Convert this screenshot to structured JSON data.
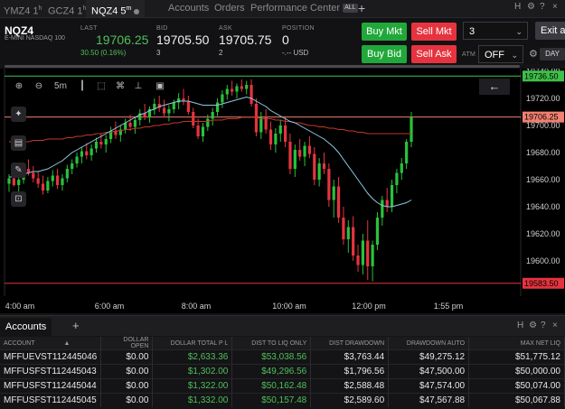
{
  "tabs": [
    {
      "label": "YMZ4 1",
      "sup": "h"
    },
    {
      "label": "GCZ4 1",
      "sup": "h"
    },
    {
      "label": "NQZ4 5",
      "sup": "m"
    },
    {
      "label": "Accounts"
    },
    {
      "label": "Orders"
    },
    {
      "label": "Performance Center"
    }
  ],
  "all_badge": "ALL",
  "add_tab": "+",
  "header_icons": [
    "H",
    "⚙",
    "?",
    "×"
  ],
  "quote": {
    "symbol": "NQZ4",
    "description": "E-MINI NASDAQ 100",
    "last_label": "LAST",
    "last": "19706.25",
    "change": "30.50 (0.16%)",
    "bid_label": "BID",
    "bid": "19705.50",
    "bid_size": "3",
    "ask_label": "ASK",
    "ask": "19705.75",
    "ask_size": "2",
    "position_label": "POSITION",
    "position": "0",
    "position_sub": "-.-- USD"
  },
  "order": {
    "buy_mkt": "Buy Mkt",
    "sell_mkt": "Sell Mkt",
    "buy_bid": "Buy Bid",
    "sell_ask": "Sell Ask",
    "quantity": "3",
    "atm_label": "ATM",
    "atm_value": "OFF",
    "exit": "Exit at",
    "day": "DAY"
  },
  "chart_toolbar": {
    "interval": "5m"
  },
  "chart_data": {
    "type": "candlestick",
    "symbol": "NQZ4",
    "y_ticks": [
      "19740.00",
      "19720.00",
      "19700.00",
      "19680.00",
      "19660.00",
      "19640.00",
      "19620.00",
      "19600.00"
    ],
    "ylim": [
      19574,
      19742
    ],
    "x_ticks": [
      "4:00 am",
      "6:00 am",
      "8:00 am",
      "10:00 am",
      "12:00 pm",
      "1:55 pm"
    ],
    "levels": [
      {
        "value": 19736.5,
        "label": "19736.50",
        "color": "#3fbf4a"
      },
      {
        "value": 19706.25,
        "label": "19706.25",
        "color": "#f08070"
      },
      {
        "value": 19583.5,
        "label": "19583.50",
        "color": "#e5343f"
      }
    ],
    "candles": [
      [
        19657,
        19664,
        19651,
        19661
      ],
      [
        19661,
        19669,
        19655,
        19656
      ],
      [
        19656,
        19664,
        19650,
        19660
      ],
      [
        19660,
        19672,
        19657,
        19668
      ],
      [
        19668,
        19675,
        19663,
        19665
      ],
      [
        19665,
        19670,
        19658,
        19661
      ],
      [
        19661,
        19666,
        19654,
        19657
      ],
      [
        19657,
        19663,
        19649,
        19652
      ],
      [
        19652,
        19662,
        19650,
        19659
      ],
      [
        19659,
        19667,
        19655,
        19663
      ],
      [
        19663,
        19668,
        19653,
        19656
      ],
      [
        19656,
        19664,
        19652,
        19661
      ],
      [
        19661,
        19671,
        19658,
        19668
      ],
      [
        19668,
        19675,
        19664,
        19672
      ],
      [
        19672,
        19680,
        19669,
        19677
      ],
      [
        19677,
        19684,
        19672,
        19681
      ],
      [
        19681,
        19687,
        19675,
        19678
      ],
      [
        19678,
        19686,
        19674,
        19683
      ],
      [
        19683,
        19691,
        19680,
        19688
      ],
      [
        19688,
        19694,
        19683,
        19686
      ],
      [
        19686,
        19693,
        19680,
        19690
      ],
      [
        19690,
        19699,
        19687,
        19696
      ],
      [
        19696,
        19703,
        19690,
        19693
      ],
      [
        19693,
        19700,
        19688,
        19697
      ],
      [
        19697,
        19705,
        19694,
        19702
      ],
      [
        19702,
        19708,
        19696,
        19699
      ],
      [
        19699,
        19706,
        19694,
        19704
      ],
      [
        19704,
        19712,
        19700,
        19709
      ],
      [
        19709,
        19716,
        19704,
        19706
      ],
      [
        19706,
        19714,
        19702,
        19712
      ],
      [
        19712,
        19720,
        19708,
        19716
      ],
      [
        19716,
        19722,
        19710,
        19713
      ],
      [
        19713,
        19719,
        19706,
        19709
      ],
      [
        19709,
        19715,
        19703,
        19712
      ],
      [
        19712,
        19719,
        19709,
        19717
      ],
      [
        19717,
        19724,
        19712,
        19720
      ],
      [
        19720,
        19727,
        19715,
        19718
      ],
      [
        19718,
        19722,
        19708,
        19710
      ],
      [
        19710,
        19713,
        19698,
        19700
      ],
      [
        19700,
        19705,
        19690,
        19692
      ],
      [
        19692,
        19702,
        19688,
        19699
      ],
      [
        19699,
        19708,
        19696,
        19705
      ],
      [
        19705,
        19713,
        19700,
        19710
      ],
      [
        19710,
        19720,
        19707,
        19717
      ],
      [
        19717,
        19726,
        19713,
        19723
      ],
      [
        19723,
        19730,
        19719,
        19727
      ],
      [
        19727,
        19733,
        19722,
        19725
      ],
      [
        19725,
        19731,
        19720,
        19729
      ],
      [
        19729,
        19734,
        19725,
        19727
      ],
      [
        19727,
        19733,
        19723,
        19730
      ],
      [
        19730,
        19734,
        19714,
        19716
      ],
      [
        19716,
        19720,
        19692,
        19695
      ],
      [
        19695,
        19710,
        19690,
        19706
      ],
      [
        19706,
        19712,
        19694,
        19697
      ],
      [
        19697,
        19703,
        19682,
        19686
      ],
      [
        19686,
        19698,
        19680,
        19694
      ],
      [
        19694,
        19704,
        19688,
        19700
      ],
      [
        19700,
        19706,
        19684,
        19688
      ],
      [
        19688,
        19694,
        19664,
        19668
      ],
      [
        19668,
        19686,
        19662,
        19682
      ],
      [
        19682,
        19690,
        19674,
        19677
      ],
      [
        19677,
        19688,
        19670,
        19685
      ],
      [
        19685,
        19692,
        19676,
        19679
      ],
      [
        19679,
        19684,
        19656,
        19660
      ],
      [
        19660,
        19676,
        19655,
        19672
      ],
      [
        19672,
        19680,
        19664,
        19668
      ],
      [
        19668,
        19672,
        19640,
        19645
      ],
      [
        19645,
        19660,
        19632,
        19655
      ],
      [
        19655,
        19662,
        19628,
        19632
      ],
      [
        19632,
        19640,
        19612,
        19616
      ],
      [
        19616,
        19630,
        19606,
        19625
      ],
      [
        19625,
        19633,
        19600,
        19604
      ],
      [
        19604,
        19612,
        19592,
        19597
      ],
      [
        19597,
        19620,
        19590,
        19615
      ],
      [
        19615,
        19630,
        19586,
        19596
      ],
      [
        19596,
        19615,
        19585,
        19612
      ],
      [
        19612,
        19636,
        19608,
        19632
      ],
      [
        19632,
        19648,
        19626,
        19645
      ],
      [
        19645,
        19654,
        19636,
        19640
      ],
      [
        19640,
        19660,
        19636,
        19656
      ],
      [
        19656,
        19668,
        19650,
        19665
      ],
      [
        19665,
        19676,
        19660,
        19672
      ],
      [
        19672,
        19690,
        19668,
        19688
      ],
      [
        19688,
        19710,
        19684,
        19706
      ]
    ],
    "ma_blue": [
      19662,
      19662,
      19663,
      19664,
      19665,
      19666,
      19666,
      19667,
      19668,
      19670,
      19672,
      19674,
      19677,
      19680,
      19682,
      19684,
      19686,
      19688,
      19690,
      19692,
      19694,
      19696,
      19698,
      19700,
      19702,
      19704,
      19706,
      19708,
      19709,
      19711,
      19712,
      19714,
      19715,
      19716,
      19717,
      19718,
      19718,
      19718,
      19717,
      19716,
      19715,
      19715,
      19715,
      19715,
      19716,
      19717,
      19718,
      19719,
      19720,
      19721,
      19720,
      19718,
      19716,
      19714,
      19711,
      19709,
      19707,
      19705,
      19703,
      19702,
      19700,
      19698,
      19696,
      19694,
      19692,
      19690,
      19687,
      19684,
      19680,
      19675,
      19670,
      19665,
      19660,
      19655,
      19650,
      19646,
      19643,
      19641,
      19640,
      19640,
      19641,
      19642,
      19643,
      19645
    ],
    "ma_red": [
      19688,
      19688,
      19688,
      19688,
      19688,
      19689,
      19689,
      19689,
      19690,
      19690,
      19690,
      19690,
      19691,
      19691,
      19692,
      19692,
      19693,
      19693,
      19694,
      19694,
      19695,
      19695,
      19696,
      19696,
      19697,
      19697,
      19698,
      19698,
      19699,
      19699,
      19700,
      19700,
      19701,
      19701,
      19702,
      19702,
      19703,
      19703,
      19703,
      19703,
      19703,
      19703,
      19704,
      19704,
      19704,
      19705,
      19705,
      19705,
      19706,
      19706,
      19706,
      19706,
      19705,
      19705,
      19705,
      19704,
      19704,
      19703,
      19703,
      19702,
      19702,
      19701,
      19700,
      19700,
      19699,
      19699,
      19698,
      19698,
      19697,
      19697,
      19696,
      19696,
      19695,
      19695,
      19694,
      19694,
      19694,
      19694,
      19694,
      19694,
      19694,
      19694,
      19694,
      19694
    ]
  },
  "accounts": {
    "tab": "Accounts",
    "add": "+",
    "icons": [
      "H",
      "⚙",
      "?",
      "×"
    ],
    "columns": [
      "ACCOUNT",
      "DOLLAR OPEN",
      "DOLLAR TOTAL P L",
      "DIST TO LIQ ONLY",
      "DIST DRAWDOWN",
      "DRAWDOWN AUTO",
      "MAX NET LIQ"
    ],
    "rows": [
      [
        "MFFUEVST112445046",
        "$0.00",
        "$2,633.36",
        "$53,038.56",
        "$3,763.44",
        "$49,275.12",
        "$51,775.12"
      ],
      [
        "MFFUSFST112445043",
        "$0.00",
        "$1,302.00",
        "$49,296.56",
        "$1,796.56",
        "$47,500.00",
        "$50,000.00"
      ],
      [
        "MFFUSFST112445044",
        "$0.00",
        "$1,322.00",
        "$50,162.48",
        "$2,588.48",
        "$47,574.00",
        "$50,074.00"
      ],
      [
        "MFFUSFST112445045",
        "$0.00",
        "$1,332.00",
        "$50,157.48",
        "$2,589.60",
        "$47,567.88",
        "$50,067.88"
      ]
    ]
  }
}
